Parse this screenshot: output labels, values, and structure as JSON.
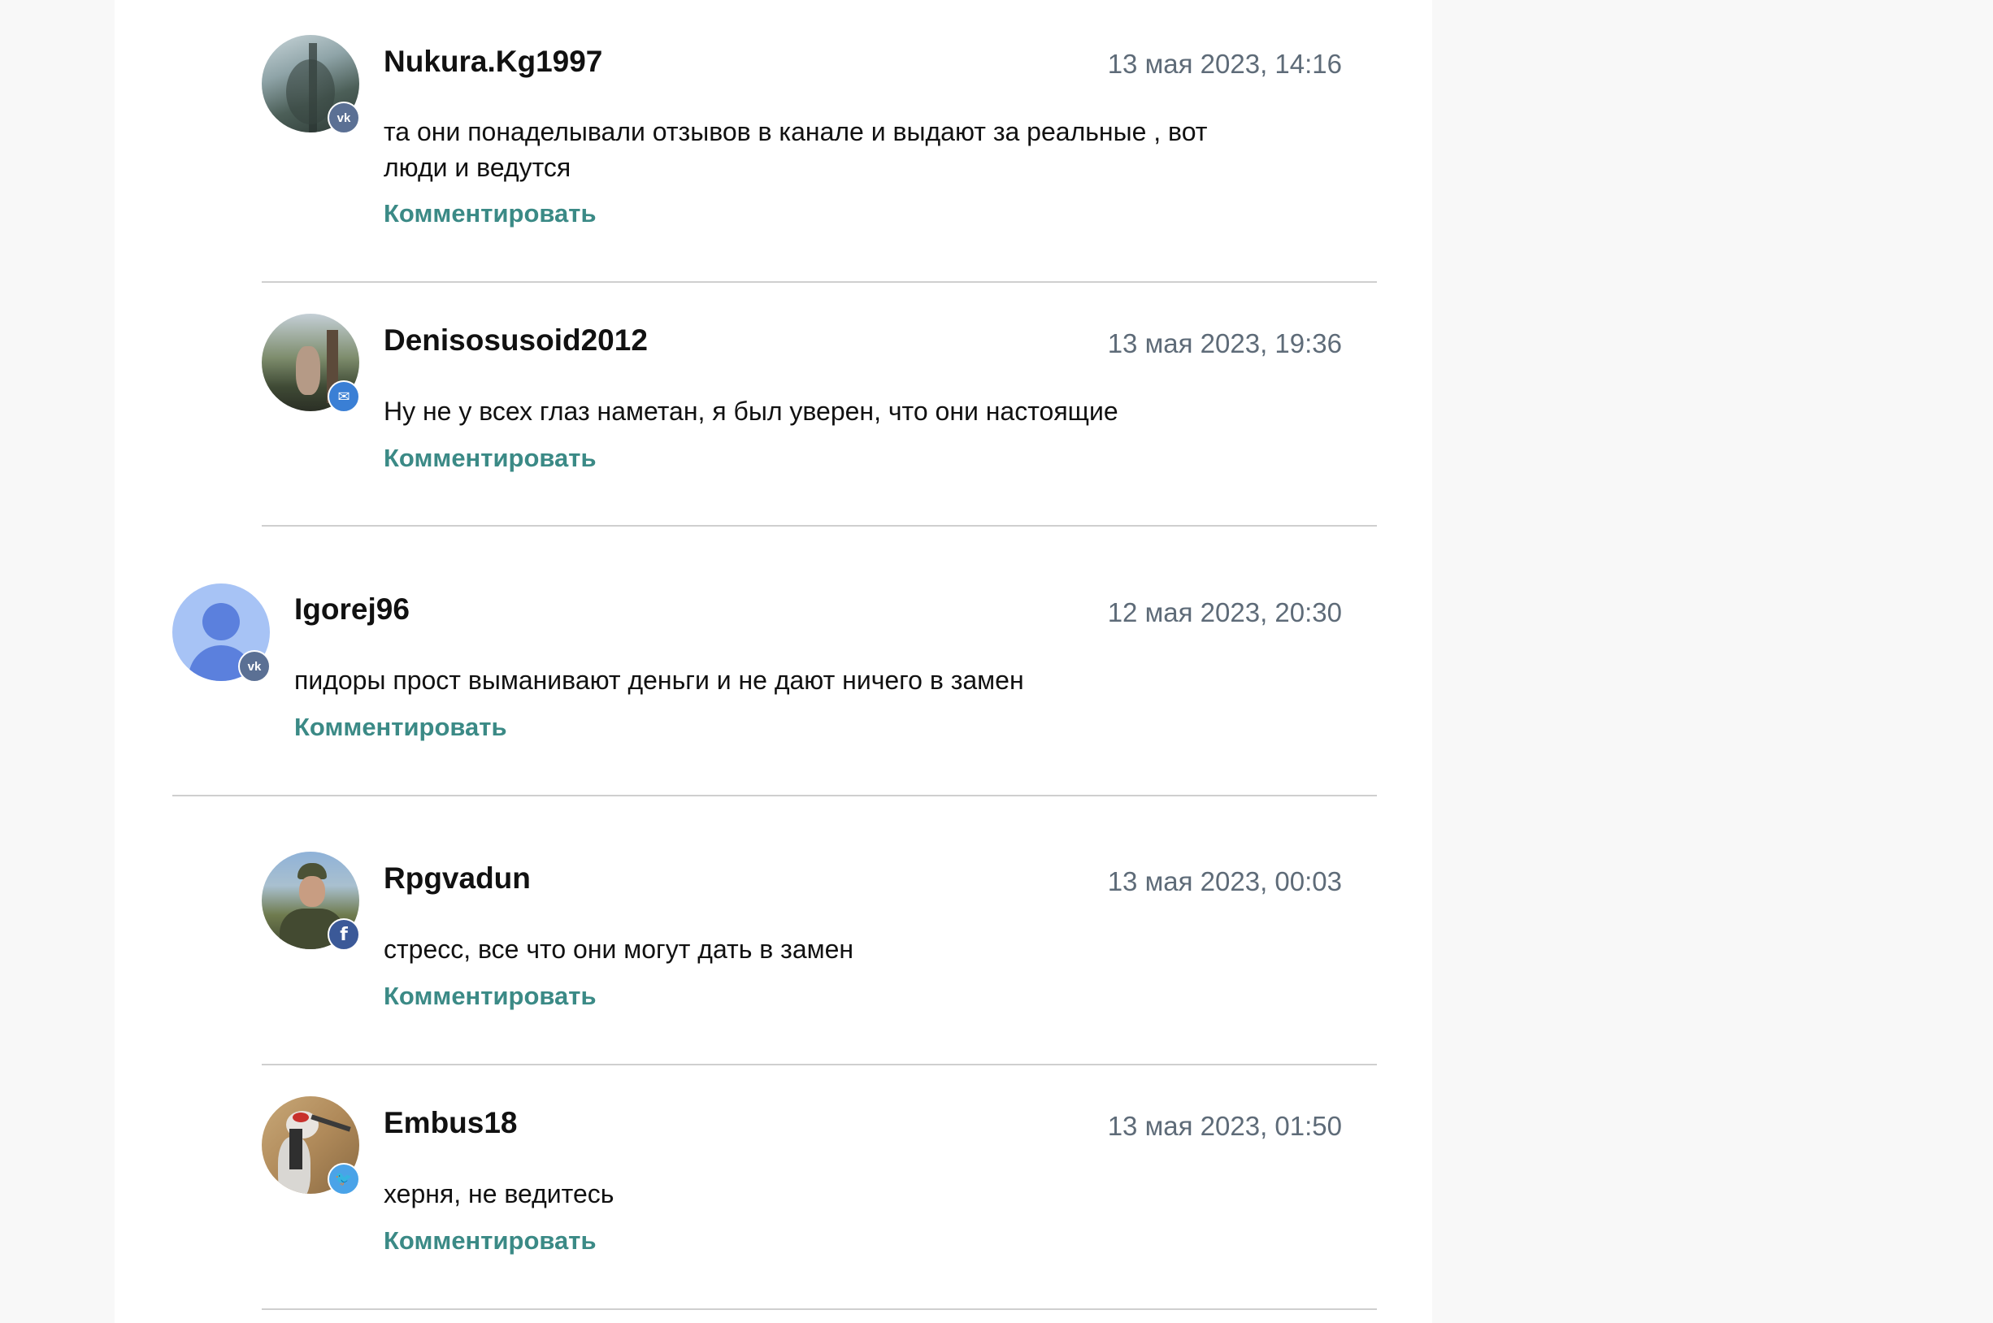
{
  "reply_label": "Комментировать",
  "badges": {
    "vk": {
      "icon": "vk-icon",
      "glyph": "vk",
      "color": "#5b7094"
    },
    "mail": {
      "icon": "mail-icon",
      "glyph": "✉",
      "color": "#3a7fd5"
    },
    "facebook": {
      "icon": "facebook-icon",
      "glyph": "f",
      "color": "#3b5998"
    },
    "twitter": {
      "icon": "twitter-icon",
      "glyph": "🐦",
      "color": "#4aa3e8"
    }
  },
  "comments": [
    {
      "author": "Nukura.Kg1997",
      "date": "13 мая 2023, 14:16",
      "text": "та они понаделывали отзывов в канале и выдают за реальные , вот люди и ведутся",
      "badge": "vk",
      "avatar": "forest-photo"
    },
    {
      "author": "Denisosusoid2012",
      "date": "13 мая 2023, 19:36",
      "text": "Ну не у всех глаз наметан, я был уверен, что они настоящие",
      "badge": "mail",
      "avatar": "person-photo"
    },
    {
      "author": "Igorej96",
      "date": "12 мая 2023, 20:30",
      "text": "пидоры прост выманивают деньги и не дают ничего в замен",
      "badge": "vk",
      "avatar": "default-user"
    },
    {
      "author": "Rpgvadun",
      "date": "13 мая 2023, 00:03",
      "text": "стресс, все что они могут дать в замен",
      "badge": "facebook",
      "avatar": "man-photo"
    },
    {
      "author": "Embus18",
      "date": "13 мая 2023, 01:50",
      "text": "херня, не ведитесь",
      "badge": "twitter",
      "avatar": "crane-photo"
    }
  ]
}
